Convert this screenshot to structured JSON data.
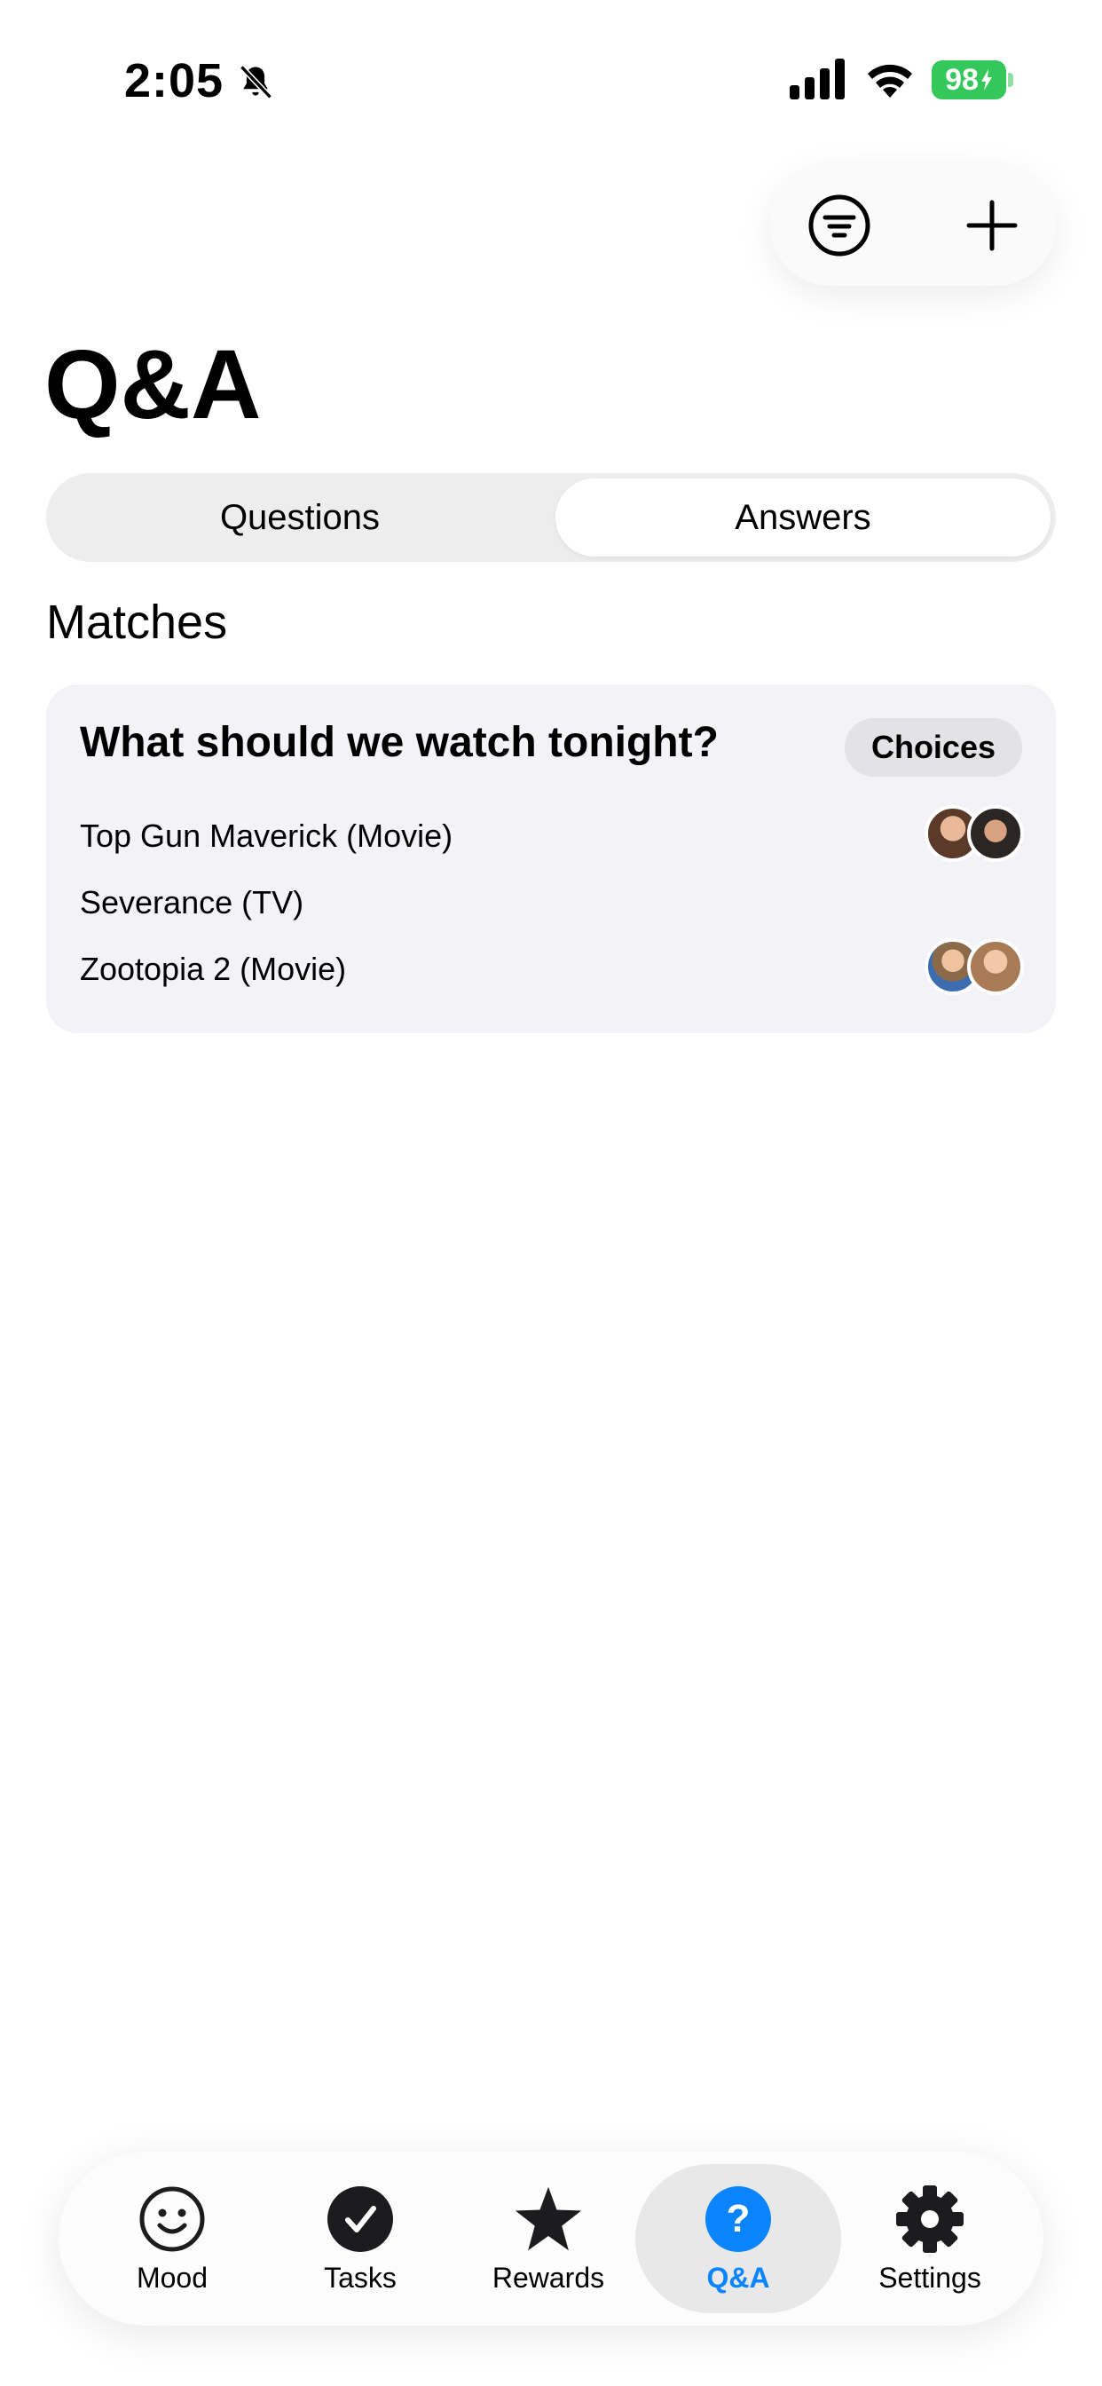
{
  "status_bar": {
    "time": "2:05",
    "battery": "98"
  },
  "page": {
    "title": "Q&A"
  },
  "segmented": {
    "options": [
      "Questions",
      "Answers"
    ],
    "selected": "Answers"
  },
  "section": {
    "title": "Matches"
  },
  "card": {
    "question": "What should we watch tonight?",
    "chip": "Choices",
    "items": [
      {
        "label": "Top Gun Maverick (Movie)",
        "avatars": [
          "avatar-woman",
          "avatar-man"
        ]
      },
      {
        "label": "Severance (TV)",
        "avatars": []
      },
      {
        "label": "Zootopia 2 (Movie)",
        "avatars": [
          "avatar-boy",
          "avatar-woman"
        ]
      }
    ]
  },
  "tabbar": {
    "items": [
      {
        "label": "Mood",
        "icon": "smiley-icon"
      },
      {
        "label": "Tasks",
        "icon": "checkmark-circle-icon"
      },
      {
        "label": "Rewards",
        "icon": "star-icon"
      },
      {
        "label": "Q&A",
        "icon": "question-circle-icon"
      },
      {
        "label": "Settings",
        "icon": "gear-icon"
      }
    ],
    "selected": "Q&A"
  },
  "colors": {
    "accent": "#0a84ff",
    "battery": "#34c759",
    "card_bg": "#f2f2f7"
  }
}
